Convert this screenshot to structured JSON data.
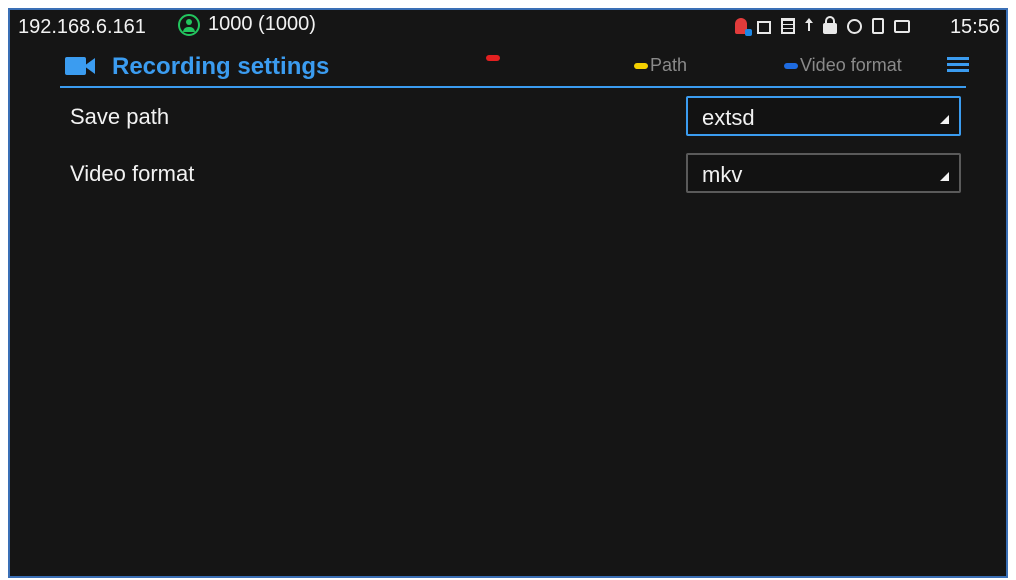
{
  "status_bar": {
    "ip": "192.168.6.161",
    "account": "1000 (1000)",
    "time": "15:56",
    "icons": [
      "alert-icon",
      "image-icon",
      "calendar-icon",
      "upload-icon",
      "lock-icon",
      "bluetooth-icon",
      "phone-icon",
      "message-icon"
    ]
  },
  "header": {
    "title": "Recording settings",
    "icon": "video-camera-icon",
    "keys": [
      {
        "color": "#e32020",
        "label": ""
      },
      {
        "color": "#f4d000",
        "label": "Path"
      },
      {
        "color": "#1e6be0",
        "label": "Video format"
      }
    ]
  },
  "settings": [
    {
      "label": "Save path",
      "value": "extsd",
      "focused": true
    },
    {
      "label": "Video format",
      "value": "mkv",
      "focused": false
    }
  ],
  "colors": {
    "accent": "#3b9cf0",
    "background": "#151515"
  }
}
